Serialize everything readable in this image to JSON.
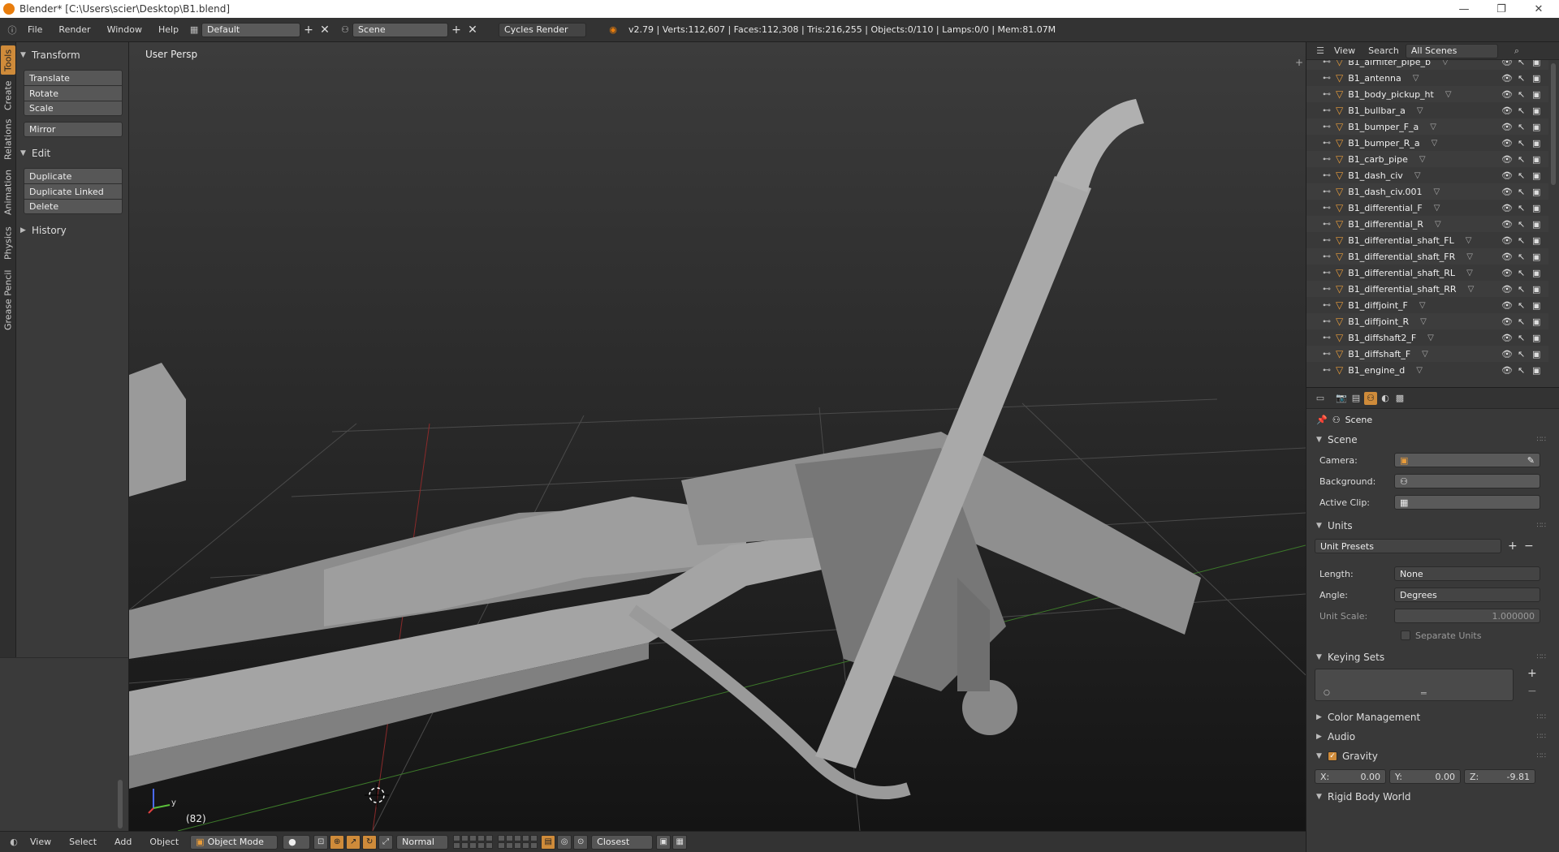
{
  "window": {
    "title": "Blender* [C:\\Users\\scier\\Desktop\\B1.blend]",
    "controls": [
      "—",
      "❐",
      "✕"
    ]
  },
  "topbar": {
    "menus": [
      "File",
      "Render",
      "Window",
      "Help"
    ],
    "screen_layout": "Default",
    "scene": "Scene",
    "render_engine": "Cycles Render",
    "stats": "v2.79 | Verts:112,607 | Faces:112,308 | Tris:216,255 | Objects:0/110 | Lamps:0/0 | Mem:81.07M"
  },
  "left_tabs": [
    "Tools",
    "Create",
    "Relations",
    "Animation",
    "Physics",
    "Grease Pencil"
  ],
  "toolshelf": {
    "transform_header": "Transform",
    "transform_buttons": [
      "Translate",
      "Rotate",
      "Scale"
    ],
    "mirror": "Mirror",
    "edit_header": "Edit",
    "edit_buttons": [
      "Duplicate",
      "Duplicate Linked",
      "Delete"
    ],
    "history_header": "History"
  },
  "viewport": {
    "label": "User Persp",
    "frame": "(82)",
    "axis_y": "y"
  },
  "viewport_header": {
    "menus": [
      "View",
      "Select",
      "Add",
      "Object"
    ],
    "mode": "Object Mode",
    "orientation": "Normal",
    "snap": "Closest"
  },
  "outliner": {
    "menus": [
      "View",
      "Search"
    ],
    "filter": "All Scenes",
    "items": [
      "B1_airfilter_pipe_b",
      "B1_antenna",
      "B1_body_pickup_ht",
      "B1_bullbar_a",
      "B1_bumper_F_a",
      "B1_bumper_R_a",
      "B1_carb_pipe",
      "B1_dash_civ",
      "B1_dash_civ.001",
      "B1_differential_F",
      "B1_differential_R",
      "B1_differential_shaft_FL",
      "B1_differential_shaft_FR",
      "B1_differential_shaft_RL",
      "B1_differential_shaft_RR",
      "B1_diffjoint_F",
      "B1_diffjoint_R",
      "B1_diffshaft2_F",
      "B1_diffshaft_F",
      "B1_engine_d"
    ]
  },
  "properties": {
    "breadcrumb": "Scene",
    "scene_header": "Scene",
    "camera_label": "Camera:",
    "background_label": "Background:",
    "active_clip_label": "Active Clip:",
    "units_header": "Units",
    "unit_presets": "Unit Presets",
    "length_label": "Length:",
    "length_value": "None",
    "angle_label": "Angle:",
    "angle_value": "Degrees",
    "unit_scale_label": "Unit Scale:",
    "unit_scale_value": "1.000000",
    "separate_units": "Separate Units",
    "keying_sets_header": "Keying Sets",
    "color_management_header": "Color Management",
    "audio_header": "Audio",
    "gravity_header": "Gravity",
    "gravity": {
      "x_label": "X:",
      "x": "0.00",
      "y_label": "Y:",
      "y": "0.00",
      "z_label": "Z:",
      "z": "-9.81"
    },
    "rigid_body_header": "Rigid Body World"
  }
}
